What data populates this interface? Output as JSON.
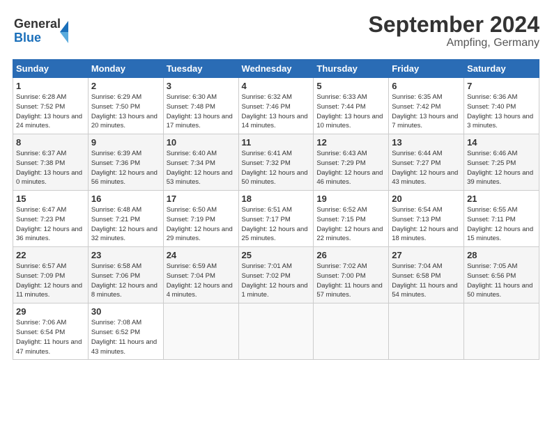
{
  "header": {
    "logo_line1": "General",
    "logo_line2": "Blue",
    "title": "September 2024",
    "subtitle": "Ampfing, Germany"
  },
  "weekdays": [
    "Sunday",
    "Monday",
    "Tuesday",
    "Wednesday",
    "Thursday",
    "Friday",
    "Saturday"
  ],
  "weeks": [
    [
      {
        "day": "1",
        "sunrise": "Sunrise: 6:28 AM",
        "sunset": "Sunset: 7:52 PM",
        "daylight": "Daylight: 13 hours and 24 minutes."
      },
      {
        "day": "2",
        "sunrise": "Sunrise: 6:29 AM",
        "sunset": "Sunset: 7:50 PM",
        "daylight": "Daylight: 13 hours and 20 minutes."
      },
      {
        "day": "3",
        "sunrise": "Sunrise: 6:30 AM",
        "sunset": "Sunset: 7:48 PM",
        "daylight": "Daylight: 13 hours and 17 minutes."
      },
      {
        "day": "4",
        "sunrise": "Sunrise: 6:32 AM",
        "sunset": "Sunset: 7:46 PM",
        "daylight": "Daylight: 13 hours and 14 minutes."
      },
      {
        "day": "5",
        "sunrise": "Sunrise: 6:33 AM",
        "sunset": "Sunset: 7:44 PM",
        "daylight": "Daylight: 13 hours and 10 minutes."
      },
      {
        "day": "6",
        "sunrise": "Sunrise: 6:35 AM",
        "sunset": "Sunset: 7:42 PM",
        "daylight": "Daylight: 13 hours and 7 minutes."
      },
      {
        "day": "7",
        "sunrise": "Sunrise: 6:36 AM",
        "sunset": "Sunset: 7:40 PM",
        "daylight": "Daylight: 13 hours and 3 minutes."
      }
    ],
    [
      {
        "day": "8",
        "sunrise": "Sunrise: 6:37 AM",
        "sunset": "Sunset: 7:38 PM",
        "daylight": "Daylight: 13 hours and 0 minutes."
      },
      {
        "day": "9",
        "sunrise": "Sunrise: 6:39 AM",
        "sunset": "Sunset: 7:36 PM",
        "daylight": "Daylight: 12 hours and 56 minutes."
      },
      {
        "day": "10",
        "sunrise": "Sunrise: 6:40 AM",
        "sunset": "Sunset: 7:34 PM",
        "daylight": "Daylight: 12 hours and 53 minutes."
      },
      {
        "day": "11",
        "sunrise": "Sunrise: 6:41 AM",
        "sunset": "Sunset: 7:32 PM",
        "daylight": "Daylight: 12 hours and 50 minutes."
      },
      {
        "day": "12",
        "sunrise": "Sunrise: 6:43 AM",
        "sunset": "Sunset: 7:29 PM",
        "daylight": "Daylight: 12 hours and 46 minutes."
      },
      {
        "day": "13",
        "sunrise": "Sunrise: 6:44 AM",
        "sunset": "Sunset: 7:27 PM",
        "daylight": "Daylight: 12 hours and 43 minutes."
      },
      {
        "day": "14",
        "sunrise": "Sunrise: 6:46 AM",
        "sunset": "Sunset: 7:25 PM",
        "daylight": "Daylight: 12 hours and 39 minutes."
      }
    ],
    [
      {
        "day": "15",
        "sunrise": "Sunrise: 6:47 AM",
        "sunset": "Sunset: 7:23 PM",
        "daylight": "Daylight: 12 hours and 36 minutes."
      },
      {
        "day": "16",
        "sunrise": "Sunrise: 6:48 AM",
        "sunset": "Sunset: 7:21 PM",
        "daylight": "Daylight: 12 hours and 32 minutes."
      },
      {
        "day": "17",
        "sunrise": "Sunrise: 6:50 AM",
        "sunset": "Sunset: 7:19 PM",
        "daylight": "Daylight: 12 hours and 29 minutes."
      },
      {
        "day": "18",
        "sunrise": "Sunrise: 6:51 AM",
        "sunset": "Sunset: 7:17 PM",
        "daylight": "Daylight: 12 hours and 25 minutes."
      },
      {
        "day": "19",
        "sunrise": "Sunrise: 6:52 AM",
        "sunset": "Sunset: 7:15 PM",
        "daylight": "Daylight: 12 hours and 22 minutes."
      },
      {
        "day": "20",
        "sunrise": "Sunrise: 6:54 AM",
        "sunset": "Sunset: 7:13 PM",
        "daylight": "Daylight: 12 hours and 18 minutes."
      },
      {
        "day": "21",
        "sunrise": "Sunrise: 6:55 AM",
        "sunset": "Sunset: 7:11 PM",
        "daylight": "Daylight: 12 hours and 15 minutes."
      }
    ],
    [
      {
        "day": "22",
        "sunrise": "Sunrise: 6:57 AM",
        "sunset": "Sunset: 7:09 PM",
        "daylight": "Daylight: 12 hours and 11 minutes."
      },
      {
        "day": "23",
        "sunrise": "Sunrise: 6:58 AM",
        "sunset": "Sunset: 7:06 PM",
        "daylight": "Daylight: 12 hours and 8 minutes."
      },
      {
        "day": "24",
        "sunrise": "Sunrise: 6:59 AM",
        "sunset": "Sunset: 7:04 PM",
        "daylight": "Daylight: 12 hours and 4 minutes."
      },
      {
        "day": "25",
        "sunrise": "Sunrise: 7:01 AM",
        "sunset": "Sunset: 7:02 PM",
        "daylight": "Daylight: 12 hours and 1 minute."
      },
      {
        "day": "26",
        "sunrise": "Sunrise: 7:02 AM",
        "sunset": "Sunset: 7:00 PM",
        "daylight": "Daylight: 11 hours and 57 minutes."
      },
      {
        "day": "27",
        "sunrise": "Sunrise: 7:04 AM",
        "sunset": "Sunset: 6:58 PM",
        "daylight": "Daylight: 11 hours and 54 minutes."
      },
      {
        "day": "28",
        "sunrise": "Sunrise: 7:05 AM",
        "sunset": "Sunset: 6:56 PM",
        "daylight": "Daylight: 11 hours and 50 minutes."
      }
    ],
    [
      {
        "day": "29",
        "sunrise": "Sunrise: 7:06 AM",
        "sunset": "Sunset: 6:54 PM",
        "daylight": "Daylight: 11 hours and 47 minutes."
      },
      {
        "day": "30",
        "sunrise": "Sunrise: 7:08 AM",
        "sunset": "Sunset: 6:52 PM",
        "daylight": "Daylight: 11 hours and 43 minutes."
      },
      null,
      null,
      null,
      null,
      null
    ]
  ]
}
